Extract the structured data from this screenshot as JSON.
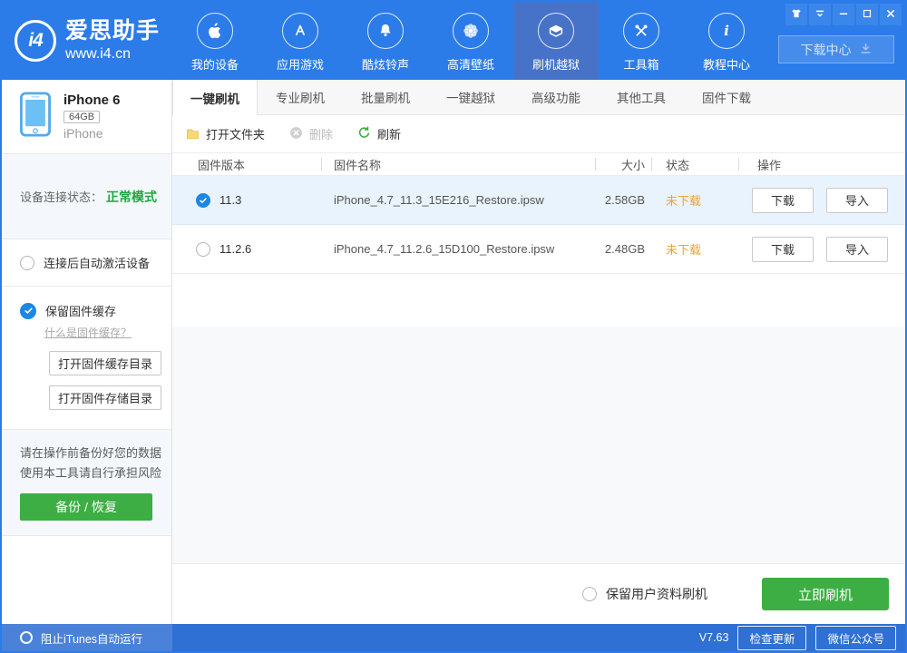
{
  "header": {
    "app_name": "爱思助手",
    "site_url": "www.i4.cn",
    "logo_mark": "i4",
    "download_center": "下载中心",
    "nav": [
      {
        "id": "my-device",
        "icon": "apple-icon",
        "label": "我的设备",
        "active": false
      },
      {
        "id": "apps-games",
        "icon": "appstore-icon",
        "label": "应用游戏",
        "active": false
      },
      {
        "id": "ringtones",
        "icon": "bell-icon",
        "label": "酷炫铃声",
        "active": false
      },
      {
        "id": "wallpapers",
        "icon": "wallpaper-icon",
        "label": "高清壁纸",
        "active": false
      },
      {
        "id": "flash-jailbreak",
        "icon": "box-icon",
        "label": "刷机越狱",
        "active": true
      },
      {
        "id": "toolbox",
        "icon": "toolbox-icon",
        "label": "工具箱",
        "active": false
      },
      {
        "id": "tutorials",
        "icon": "info-icon",
        "label": "教程中心",
        "active": false
      }
    ],
    "window_controls": [
      {
        "id": "skin",
        "icon": "shirt-icon"
      },
      {
        "id": "menu",
        "icon": "menu-down-icon"
      },
      {
        "id": "minimize",
        "icon": "minimize-icon"
      },
      {
        "id": "maximize",
        "icon": "maximize-icon"
      },
      {
        "id": "close",
        "icon": "close-icon"
      }
    ]
  },
  "sidebar": {
    "device": {
      "name": "iPhone 6",
      "capacity": "64GB",
      "type": "iPhone"
    },
    "connection_label": "设备连接状态：",
    "connection_value": "正常模式",
    "auto_activate": {
      "label": "连接后自动激活设备",
      "checked": false
    },
    "keep_cache": {
      "label": "保留固件缓存",
      "checked": true
    },
    "cache_link": "什么是固件缓存？",
    "open_cache_dir": "打开固件缓存目录",
    "open_storage_dir": "打开固件存储目录",
    "warning_line1": "请在操作前备份好您的数据",
    "warning_line2": "使用本工具请自行承担风险",
    "backup_button": "备份 / 恢复",
    "block_itunes": {
      "label": "阻止iTunes自动运行",
      "checked": false
    }
  },
  "tabs": [
    {
      "id": "one-key-flash",
      "label": "一键刷机",
      "active": true
    },
    {
      "id": "pro-flash",
      "label": "专业刷机",
      "active": false
    },
    {
      "id": "batch-flash",
      "label": "批量刷机",
      "active": false
    },
    {
      "id": "one-key-jailbreak",
      "label": "一键越狱",
      "active": false
    },
    {
      "id": "advanced",
      "label": "高级功能",
      "active": false
    },
    {
      "id": "other-tools",
      "label": "其他工具",
      "active": false
    },
    {
      "id": "firmware-download",
      "label": "固件下载",
      "active": false
    }
  ],
  "toolbar": {
    "open_folder": "打开文件夹",
    "delete": "删除",
    "refresh": "刷新"
  },
  "firmware_table": {
    "columns": [
      "固件版本",
      "固件名称",
      "大小",
      "状态",
      "操作"
    ],
    "rows": [
      {
        "version": "11.3",
        "name": "iPhone_4.7_11.3_15E216_Restore.ipsw",
        "size": "2.58GB",
        "status": "未下载",
        "selected": true,
        "download": "下载",
        "import": "导入"
      },
      {
        "version": "11.2.6",
        "name": "iPhone_4.7_11.2.6_15D100_Restore.ipsw",
        "size": "2.48GB",
        "status": "未下载",
        "selected": false,
        "download": "下载",
        "import": "导入"
      }
    ]
  },
  "footer": {
    "keep_user_data": "保留用户资料刷机",
    "flash_now": "立即刷机"
  },
  "statusbar": {
    "version": "V7.63",
    "check_update": "检查更新",
    "wechat": "微信公众号"
  },
  "icons": {
    "folder-icon": "yellow folder",
    "delete-icon": "gray circle with x",
    "refresh-icon": "green circular arrow",
    "download-icon": "arrow down to tray",
    "check-icon": "white checkmark",
    "phone-icon": "iphone outline"
  },
  "colors": {
    "header_blue": "#2b7ce9",
    "nav_active_blue": "#4673c8",
    "accent_green": "#3cae43",
    "status_green_text": "#1ea83e",
    "status_orange": "#efa234",
    "radio_blue": "#1d87e4",
    "selected_row": "#e9f3fd",
    "statusbar_left": "#4b82d9",
    "statusbar_right": "#2e70d3"
  }
}
